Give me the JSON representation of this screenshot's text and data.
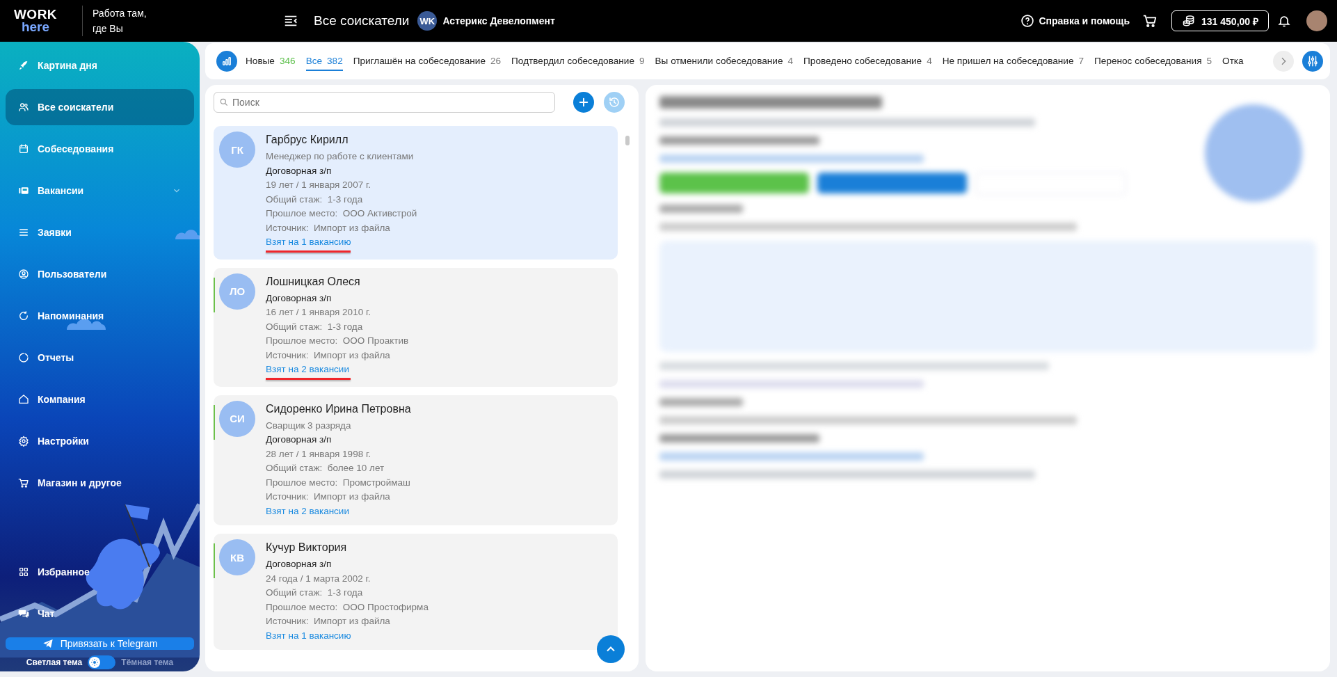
{
  "header": {
    "logo": {
      "top": "WORK",
      "bottom": "here"
    },
    "tagline": "Работа там,\nгде Вы",
    "page_title": "Все соискатели",
    "company": {
      "initials": "WK",
      "name": "Астерикс Девелопмент"
    },
    "help": "Справка и помощь",
    "balance": "131 450,00 ₽"
  },
  "sidebar": {
    "items": [
      {
        "label": "Картина дня",
        "selected": false,
        "has_submenu": false
      },
      {
        "label": "Все соискатели",
        "selected": true,
        "has_submenu": false
      },
      {
        "label": "Собеседования",
        "selected": false,
        "has_submenu": false
      },
      {
        "label": "Вакансии",
        "selected": false,
        "has_submenu": true
      },
      {
        "label": "Заявки",
        "selected": false,
        "has_submenu": false
      },
      {
        "label": "Пользователи",
        "selected": false,
        "has_submenu": false
      },
      {
        "label": "Напоминания",
        "selected": false,
        "has_submenu": false
      },
      {
        "label": "Отчеты",
        "selected": false,
        "has_submenu": false
      },
      {
        "label": "Компания",
        "selected": false,
        "has_submenu": false
      },
      {
        "label": "Настройки",
        "selected": false,
        "has_submenu": false
      },
      {
        "label": "Магазин и другое",
        "selected": false,
        "has_submenu": false
      }
    ],
    "bottom_items": [
      {
        "label": "Избранное",
        "selected": false,
        "has_submenu": false
      },
      {
        "label": "Чат",
        "selected": false,
        "has_submenu": false
      }
    ],
    "telegram_button": "Привязать к Telegram",
    "theme": {
      "light_label": "Светлая тема",
      "dark_label": "Тёмная тема",
      "dark": false
    }
  },
  "tabs": [
    {
      "label": "Новые",
      "count": "346",
      "selected": false,
      "color": "#5cbf4a"
    },
    {
      "label": "Все",
      "count": "382",
      "selected": true,
      "color": "#1a7fd8"
    },
    {
      "label": "Приглашён на собеседование",
      "count": "26",
      "selected": false,
      "color": "#777777"
    },
    {
      "label": "Подтвердил собеседование",
      "count": "9",
      "selected": false,
      "color": "#777777"
    },
    {
      "label": "Вы отменили собеседование",
      "count": "4",
      "selected": false,
      "color": "#777777"
    },
    {
      "label": "Проведено собеседование",
      "count": "4",
      "selected": false,
      "color": "#777777"
    },
    {
      "label": "Не пришел на собеседование",
      "count": "7",
      "selected": false,
      "color": "#777777"
    },
    {
      "label": "Перенос собеседования",
      "count": "5",
      "selected": false,
      "color": "#777777"
    },
    {
      "label": "Отка",
      "selected": false
    }
  ],
  "search": {
    "placeholder": "Поиск"
  },
  "candidates": [
    {
      "initials": "ГК",
      "name": "Гарбрус Кирилл",
      "position": "Менеджер по работе с клиентами",
      "salary": "Договорная з/п",
      "age": "19 лет / 1 января 2007 г.",
      "experience_label": "Общий стаж:",
      "experience": "1-3 года",
      "last_place_label": "Прошлое место:",
      "last_place": "ООО Активстрой",
      "source_label": "Источник:",
      "source": "Импорт из файла",
      "vacancies": "Взят на 1 вакансию",
      "selected": true,
      "accent_bar": false,
      "highlighted": true
    },
    {
      "initials": "ЛО",
      "name": "Лошницкая Олеся",
      "salary": "Договорная з/п",
      "age": "16 лет / 1 января 2010 г.",
      "experience_label": "Общий стаж:",
      "experience": "1-3 года",
      "last_place_label": "Прошлое место:",
      "last_place": "ООО Проактив",
      "source_label": "Источник:",
      "source": "Импорт из файла",
      "vacancies": "Взят на 2 вакансии",
      "selected": false,
      "accent_bar": true,
      "highlighted": true
    },
    {
      "initials": "СИ",
      "name": "Сидоренко Ирина Петровна",
      "position": "Сварщик 3 разряда",
      "salary": "Договорная з/п",
      "age": "28 лет / 1 января 1998 г.",
      "experience_label": "Общий стаж:",
      "experience": "более 10 лет",
      "last_place_label": "Прошлое место:",
      "last_place": "Промстроймаш",
      "source_label": "Источник:",
      "source": "Импорт из файла",
      "vacancies": "Взят на 2 вакансии",
      "selected": false,
      "accent_bar": true,
      "highlighted": false
    },
    {
      "initials": "КВ",
      "name": "Кучур Виктория",
      "salary": "Договорная з/п",
      "age": "24 года / 1 марта 2002 г.",
      "experience_label": "Общий стаж:",
      "experience": "1-3 года",
      "last_place_label": "Прошлое место:",
      "last_place": "ООО Простофирма",
      "source_label": "Источник:",
      "source": "Импорт из файла",
      "vacancies": "Взят на 1 вакансию",
      "selected": false,
      "accent_bar": true,
      "highlighted": false
    }
  ]
}
